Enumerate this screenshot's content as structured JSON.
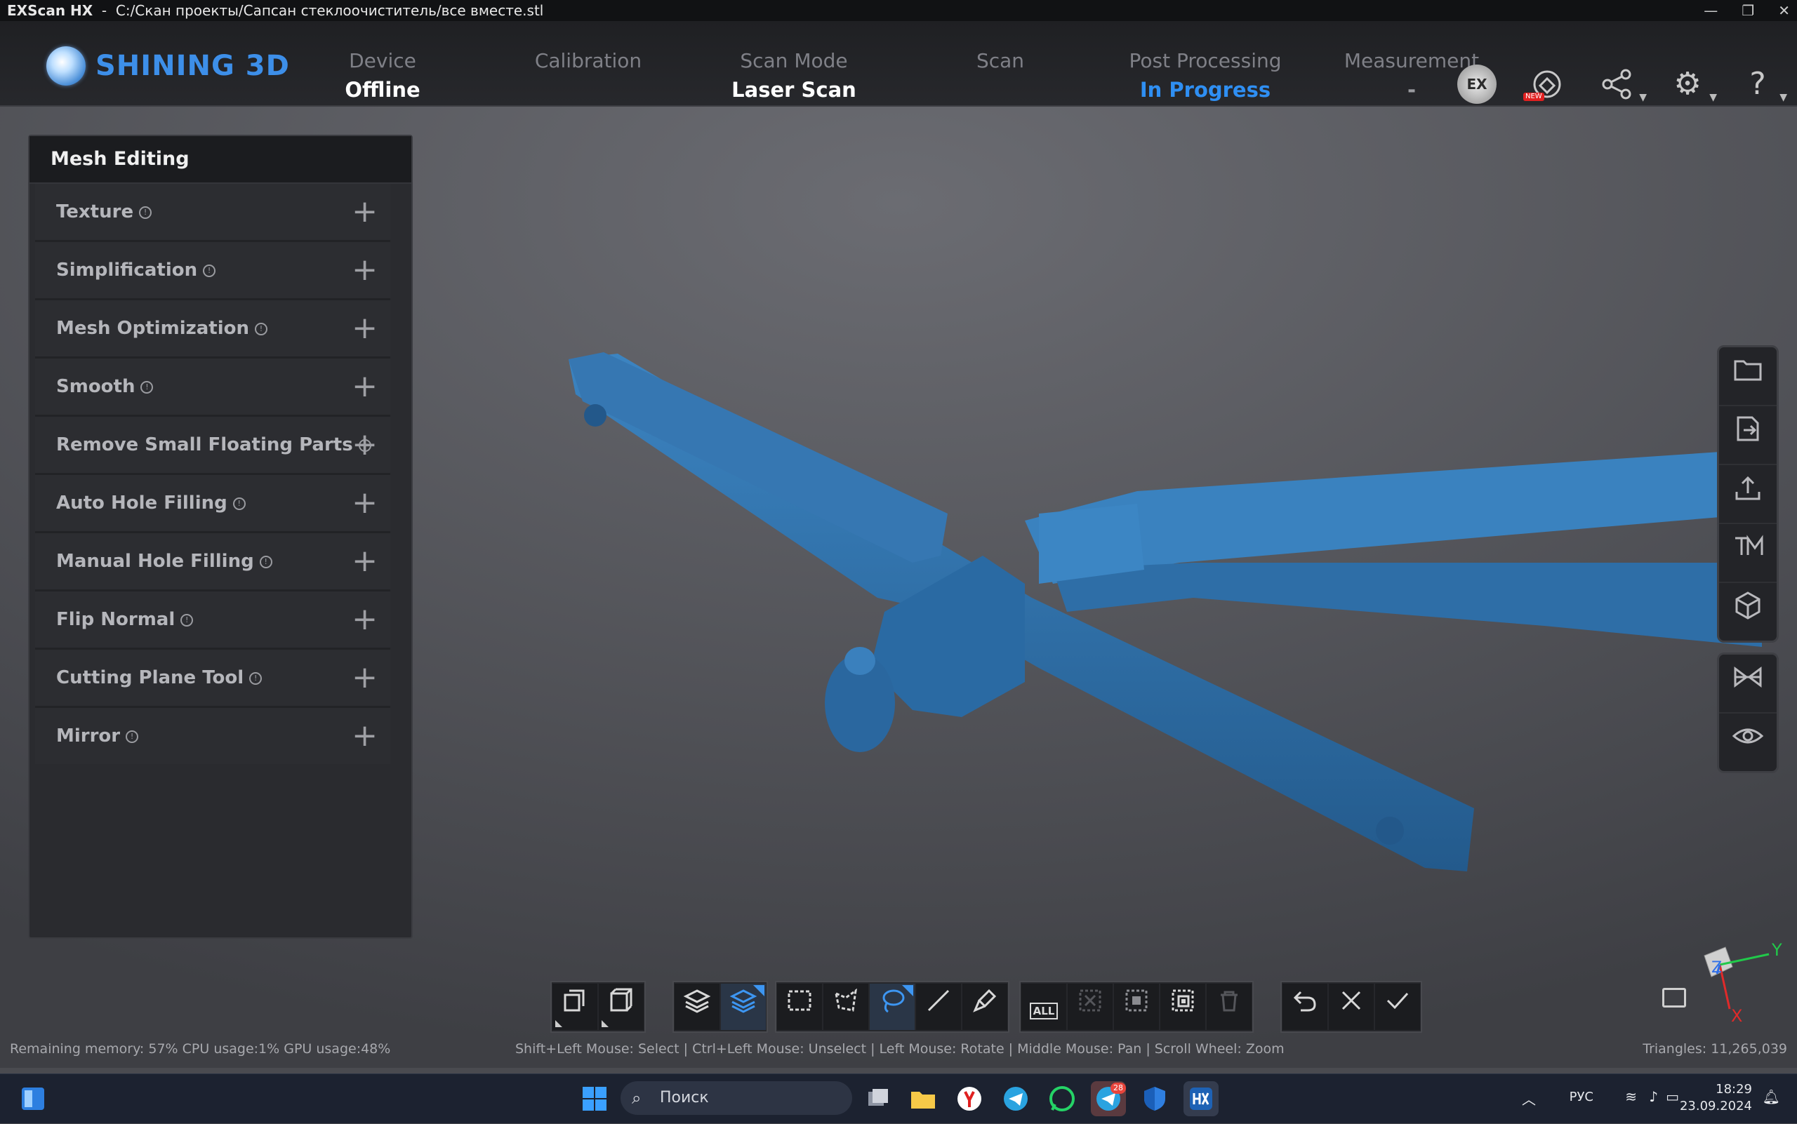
{
  "window": {
    "app_name": "EXScan HX",
    "separator": "-",
    "file_path": "C:/Скан проекты/Сапсан стеклоочиститель/все вместе.stl",
    "controls": [
      "—",
      "❐",
      "✕"
    ]
  },
  "brand": {
    "name": "SHINING 3D",
    "color": "#3d8fe9"
  },
  "steps": [
    {
      "label": "Device",
      "value": "Offline",
      "state": "sync"
    },
    {
      "label": "Calibration",
      "value": "",
      "state": "pending"
    },
    {
      "label": "Scan Mode",
      "value": "Laser Scan",
      "state": "pending"
    },
    {
      "label": "Scan",
      "value": "",
      "state": "pending"
    },
    {
      "label": "Post Processing",
      "value": "In Progress",
      "state": "current"
    },
    {
      "label": "Measurement",
      "value": "-",
      "state": "pending"
    }
  ],
  "header_icons": {
    "ex_model": "EX",
    "new_badge": "NEW",
    "ex_model_name": "ex-model-icon",
    "cloud_name": "cloud-model-icon",
    "share_name": "share-icon",
    "settings_name": "gear-icon",
    "help_name": "help-icon"
  },
  "panel": {
    "title": "Mesh Editing",
    "items": [
      {
        "label": "Texture"
      },
      {
        "label": "Simplification"
      },
      {
        "label": "Mesh Optimization"
      },
      {
        "label": "Smooth"
      },
      {
        "label": "Remove Small Floating Parts"
      },
      {
        "label": "Auto Hole Filling"
      },
      {
        "label": "Manual Hole Filling"
      },
      {
        "label": "Flip Normal"
      },
      {
        "label": "Cutting Plane Tool"
      },
      {
        "label": "Mirror"
      }
    ],
    "expand_glyph": "+",
    "info_glyph": "!"
  },
  "right_toolbar": {
    "group1": [
      "folder-icon",
      "export-icon",
      "upload-icon",
      "tm-icon",
      "cube-icon"
    ],
    "group2": [
      "mirror-view-icon",
      "eye-icon"
    ]
  },
  "bottom_toolbar": {
    "all_label": "ALL"
  },
  "status": {
    "left": "Remaining memory: 57% CPU usage:1%  GPU usage:48%",
    "center": "Shift+Left Mouse: Select | Ctrl+Left Mouse: Unselect | Left Mouse: Rotate | Middle Mouse: Pan | Scroll Wheel: Zoom",
    "right": "Triangles: 11,265,039"
  },
  "axes": {
    "y": "Y",
    "z": "Z",
    "x": "X"
  },
  "mesh_color": "#2f6fa8",
  "taskbar": {
    "search_placeholder": "Поиск",
    "language": "РУС",
    "time": "18:29",
    "date": "23.09.2024",
    "telegram_badge": "28"
  }
}
